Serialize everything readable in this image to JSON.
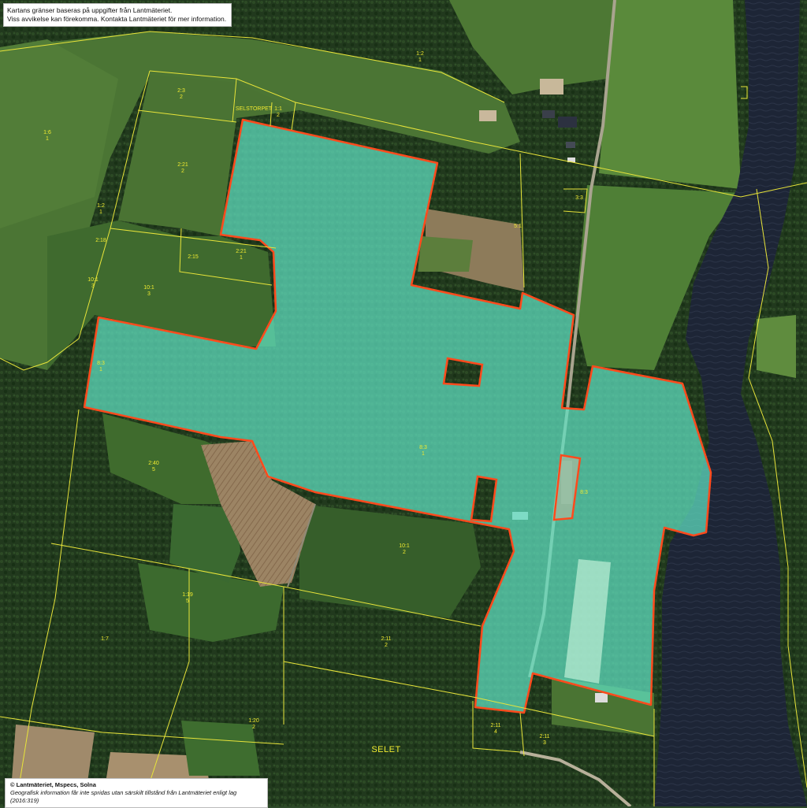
{
  "disclaimer": {
    "line1": "Kartans gränser baseras på uppgifter från Lantmäteriet.",
    "line2": "Viss avvikelse kan förekomma. Kontakta Lantmäteriet för mer information."
  },
  "copyright": {
    "line1": "© Lantmäteriet, Mspecs, Solna",
    "line2": "Geografisk information får inte spridas utan särskilt tillstånd från Lantmäteriet enligt lag (2016:319)"
  },
  "place_name": "SELET",
  "parcel_labels": [
    {
      "id": "p-1-2",
      "name": "1:2",
      "sub": "1"
    },
    {
      "id": "p-2-3",
      "name": "2:3",
      "sub": "2"
    },
    {
      "id": "p-selstorpet",
      "name": "SELSTORPET",
      "sub": ""
    },
    {
      "id": "p-1-1",
      "name": "1:1",
      "sub": "2"
    },
    {
      "id": "p-1-6",
      "name": "1:6",
      "sub": "1"
    },
    {
      "id": "p-2-21",
      "name": "2:21",
      "sub": "2"
    },
    {
      "id": "p-1-2b",
      "name": "1:2",
      "sub": "1"
    },
    {
      "id": "p-2-18",
      "name": "2:18",
      "sub": ""
    },
    {
      "id": "p-2-15",
      "name": "2:15",
      "sub": ""
    },
    {
      "id": "p-2-21b",
      "name": "2:21",
      "sub": "1"
    },
    {
      "id": "p-10-1a",
      "name": "10:1",
      "sub": "3"
    },
    {
      "id": "p-10-1b",
      "name": "10:1",
      "sub": "3"
    },
    {
      "id": "p-8-3a",
      "name": "8:3",
      "sub": "1"
    },
    {
      "id": "p-3-3",
      "name": "3:3",
      "sub": ""
    },
    {
      "id": "p-5-1",
      "name": "5:1",
      "sub": ""
    },
    {
      "id": "p-8-3b",
      "name": "8:3",
      "sub": "1"
    },
    {
      "id": "p-8-3c",
      "name": "8:3",
      "sub": ""
    },
    {
      "id": "p-2-40",
      "name": "2:40",
      "sub": "5"
    },
    {
      "id": "p-10-1c",
      "name": "10:1",
      "sub": "2"
    },
    {
      "id": "p-1-19",
      "name": "1:19",
      "sub": "5"
    },
    {
      "id": "p-1-7",
      "name": "1:7",
      "sub": ""
    },
    {
      "id": "p-2-11a",
      "name": "2:11",
      "sub": "2"
    },
    {
      "id": "p-1-20",
      "name": "1:20",
      "sub": "2"
    },
    {
      "id": "p-2-11b",
      "name": "2:11",
      "sub": "4"
    },
    {
      "id": "p-2-11c",
      "name": "2:11",
      "sub": "3"
    }
  ],
  "colors": {
    "highlight_fill": "#5fe0c2",
    "highlight_stroke": "#ff4a1c",
    "boundary_line": "#e8e43a",
    "river": "#1d2536",
    "forest": "#1f3a1c",
    "field": "#4d7a36",
    "bare_field": "#9a8060"
  }
}
